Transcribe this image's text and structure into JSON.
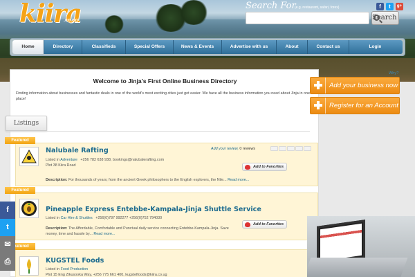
{
  "header": {
    "logo_text": "kiira",
    "logo_tld": ".co.ug",
    "search_label": "Search For",
    "search_hint": "(e.g. restaurant, safari, forex)",
    "search_placeholder": "",
    "search_button": "Search",
    "social": [
      {
        "icon": "facebook-icon",
        "glyph": "f",
        "color": "#3b5998"
      },
      {
        "icon": "twitter-icon",
        "glyph": "t",
        "color": "#1da1f2"
      },
      {
        "icon": "google-plus-icon",
        "glyph": "g+",
        "color": "#dd4b39"
      }
    ]
  },
  "nav": {
    "items": [
      {
        "label": "Home",
        "active": true
      },
      {
        "label": "Directory"
      },
      {
        "label": "Classifieds"
      },
      {
        "label": "Special Offers"
      },
      {
        "label": "News & Events"
      },
      {
        "label": "Advertise with us"
      },
      {
        "label": "About"
      },
      {
        "label": "Contact us"
      },
      {
        "label": "Login"
      }
    ]
  },
  "main": {
    "welcome": "Welcome to Jinja's First Online Business Directory",
    "intro": "Finding information about businesses and fantastic deals in one of the world's most exciting cities just got easier. We have all the business information you need about Jinja in one place!",
    "listings_tab": "Listings",
    "featured_label": "Featured",
    "add_review": "Add your review,",
    "favorites_label": "Add to Favorites",
    "description_label": "Description:",
    "read_more": "Read more...",
    "listed_in": "Listed in",
    "listings": [
      {
        "title": "Nalubale Rafting",
        "category": "Adventure",
        "contact": "+256 782 638 938, bookings@nalubalerafting.com",
        "address": "Plot 38 Kiira Road",
        "reviews": "0 reviews",
        "description": "For thousands of years; from the ancient Greek philosophers to the English explorers, the Nile..."
      },
      {
        "title": "Pineapple Express Entebbe-Kampala-Jinja Shuttle Service",
        "category": "Car Hire & Shuttles",
        "contact": "+256(0)787 992277 +256(0)752 794030",
        "address": "",
        "reviews": "0 reviews",
        "description": "The Affordable, Comfortable and Punctual daily service connecting Entebbe-Kampala-Jinja. Save money, time and hassle by..."
      },
      {
        "title": "KUGSTEL Foods",
        "category": "Food Production",
        "contact": "Plot 15 Eng Zikusooka Way, +256 775 661 400, kugstelfoods@kiira.co.ug",
        "address": "",
        "reviews": "",
        "description": ""
      }
    ]
  },
  "sidebar": {
    "why_link": "Why?",
    "cta_add": "Add your business now",
    "cta_register": "Register for an Account"
  },
  "share_rail": [
    {
      "icon": "facebook-icon",
      "glyph": "f",
      "color": "#3b5998"
    },
    {
      "icon": "twitter-icon",
      "glyph": "t",
      "color": "#1da1f2"
    },
    {
      "icon": "email-icon",
      "glyph": "✉",
      "color": "#7a7a7a"
    },
    {
      "icon": "print-icon",
      "glyph": "⎙",
      "color": "#7a7a7a"
    }
  ],
  "colors": {
    "brand_orange": "#f5a317",
    "nav_blue": "#2f6f99",
    "link_blue": "#1b6a8e",
    "card_bg": "#fff5d6"
  }
}
